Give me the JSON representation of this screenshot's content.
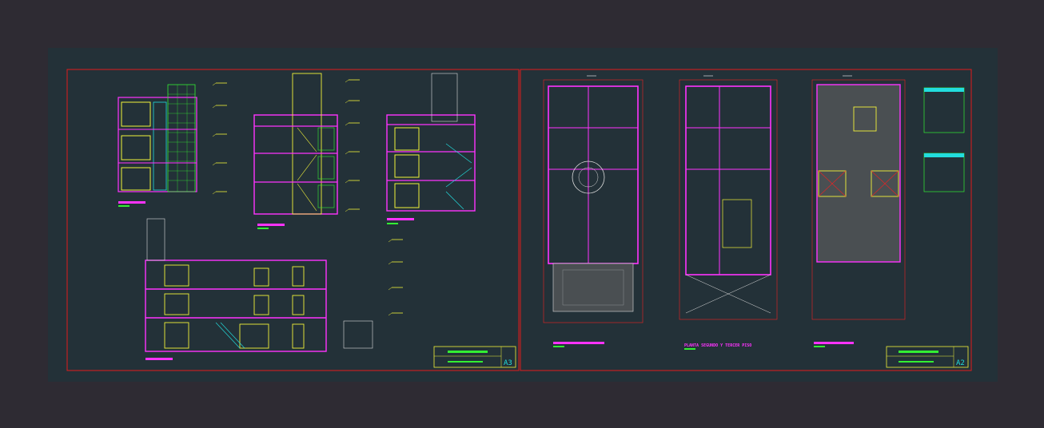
{
  "drawing": {
    "colors": {
      "background": "#2e2b33",
      "model_space": "#233138",
      "frame": "#e01b1b",
      "wall": "#ff33ff",
      "line_yellow": "#f2f23a",
      "line_cyan": "#22dddd",
      "line_green": "#33ee33",
      "line_white": "#dddddd",
      "line_red": "#ee2222",
      "line_blue": "#3366ff"
    },
    "sheets": [
      {
        "id": "left",
        "sheet_number": "A3"
      },
      {
        "id": "right",
        "sheet_number": "A2"
      }
    ],
    "plan_titles": {
      "second_third_floor": "PLANTA SEGUNDO Y TERCER PISO"
    }
  }
}
